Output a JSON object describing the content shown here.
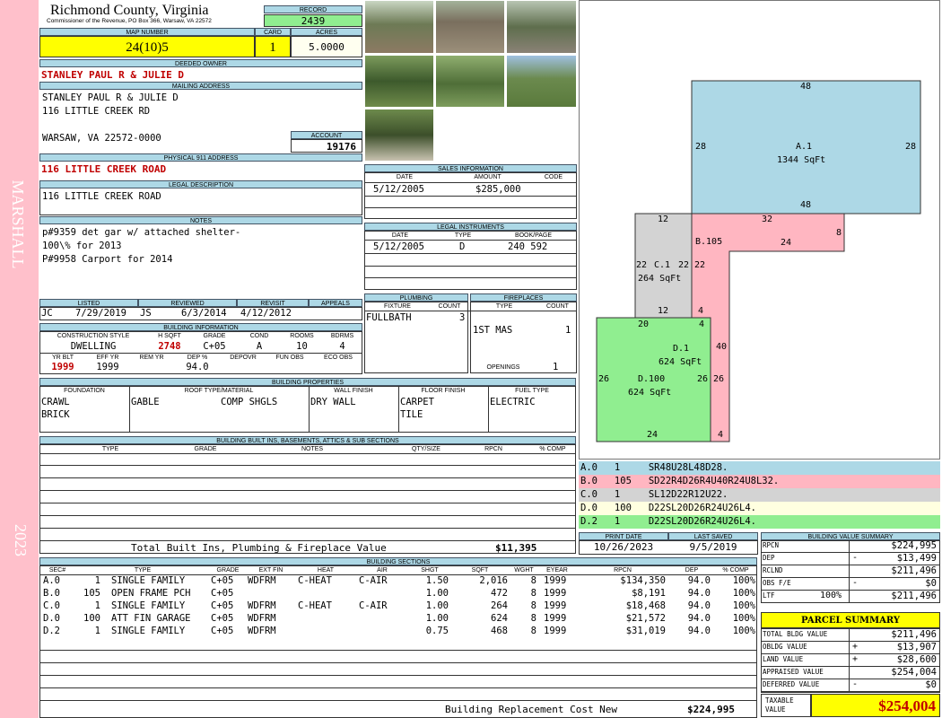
{
  "sidebar": {
    "district": "MARSHALL",
    "year": "2023"
  },
  "header": {
    "county": "Richmond County, Virginia",
    "commissioner": "Commissioner of the Revenue, PO Box 366, Warsaw, VA 22572"
  },
  "record": {
    "label": "RECORD",
    "value": "2439"
  },
  "map": {
    "map_label": "MAP NUMBER",
    "map_number": "24(10)5",
    "card_label": "CARD",
    "card": "1",
    "acres_label": "ACRES",
    "acres": "5.0000"
  },
  "owner": {
    "deeded_label": "DEEDED OWNER",
    "deeded": "STANLEY PAUL R & JULIE D",
    "mailing_label": "MAILING ADDRESS",
    "mailing_lines": [
      "STANLEY PAUL R & JULIE D",
      "116 LITTLE CREEK RD",
      "",
      "WARSAW, VA 22572-0000"
    ],
    "account_label": "ACCOUNT",
    "account": "19176"
  },
  "physical": {
    "label": "PHYSICAL 911 ADDRESS",
    "value": "116 LITTLE CREEK ROAD"
  },
  "legal": {
    "label": "LEGAL DESCRIPTION",
    "value": "116 LITTLE CREEK ROAD"
  },
  "notes": {
    "label": "NOTES",
    "lines": [
      "p#9359 det gar w/ attached shelter-",
      "100\\% for 2013",
      "P#9958 Carport for 2014"
    ]
  },
  "sales": {
    "label": "SALES INFORMATION",
    "cols": [
      "DATE",
      "AMOUNT",
      "CODE"
    ],
    "rows": [
      {
        "date": "5/12/2005",
        "amount": "$285,000",
        "code": ""
      }
    ]
  },
  "legal_instruments": {
    "label": "LEGAL INSTRUMENTS",
    "cols": [
      "DATE",
      "TYPE",
      "BOOK/PAGE"
    ],
    "rows": [
      {
        "date": "5/12/2005",
        "type": "D",
        "book": "240 592"
      }
    ]
  },
  "listing": {
    "cols": [
      "LISTED",
      "REVIEWED",
      "REVISIT",
      "APPEALS"
    ],
    "listed_by": "JC",
    "listed_date": "7/29/2019",
    "reviewed_by": "JS",
    "reviewed_date": "6/3/2014",
    "revisit": "4/12/2012",
    "appeals": ""
  },
  "building_info": {
    "label": "BUILDING INFORMATION",
    "cols": [
      "CONSTRUCTION STYLE",
      "H SQFT",
      "GRADE",
      "COND",
      "ROOMS",
      "BDRMS"
    ],
    "style": "DWELLING",
    "hsqft": "2748",
    "grade": "C+05",
    "cond": "A",
    "rooms": "10",
    "bdrms": "4",
    "cols2": [
      "YR BLT",
      "EFF YR",
      "REM YR",
      "DEP %",
      "DEPOVR",
      "FUN OBS",
      "ECO OBS"
    ],
    "yr_blt": "1999",
    "eff_yr": "1999",
    "rem_yr": "",
    "dep": "94.0",
    "depovr": "",
    "fun_obs": "",
    "eco_obs": ""
  },
  "plumbing": {
    "label": "PLUMBING",
    "cols": [
      "FIXTURE",
      "COUNT"
    ],
    "fixture": "FULLBATH",
    "count": "3"
  },
  "fireplaces": {
    "label": "FIREPLACES",
    "cols": [
      "TYPE",
      "COUNT"
    ],
    "type": "1ST MAS",
    "count": "1",
    "openings_label": "OPENINGS",
    "openings": "1"
  },
  "properties": {
    "label": "BUILDING PROPERTIES",
    "cols": [
      "FOUNDATION",
      "ROOF TYPE/MATERIAL",
      "WALL FINISH",
      "FLOOR FINISH",
      "FUEL TYPE"
    ],
    "foundation": [
      "CRAWL",
      "BRICK"
    ],
    "roof_type": "GABLE",
    "roof_mat": "COMP SHGLS",
    "wall": "DRY WALL",
    "floor": [
      "CARPET",
      "TILE"
    ],
    "fuel": "ELECTRIC"
  },
  "builtins": {
    "label": "BUILDING BUILT INS, BASEMENTS, ATTICS & SUB SECTIONS",
    "cols": [
      "TYPE",
      "GRADE",
      "NOTES",
      "QTY/SIZE",
      "RPCN",
      "% COMP"
    ],
    "total_label": "Total Built Ins, Plumbing & Fireplace Value",
    "total": "$11,395"
  },
  "sketch": {
    "areas": [
      {
        "code": "A.1",
        "sqft": "1344 SqFt"
      },
      {
        "code": "B.105",
        "sqft": ""
      },
      {
        "code": "C.1",
        "sqft": "264 SqFt"
      },
      {
        "code": "D.1",
        "sqft": "624 SqFt"
      },
      {
        "code": "D.100",
        "sqft": "624 SqFt"
      }
    ],
    "dims": [
      "48",
      "28",
      "28",
      "48",
      "12",
      "32",
      "24",
      "8",
      "22",
      "22",
      "22",
      "12",
      "4",
      "40",
      "20",
      "4",
      "26",
      "26",
      "26",
      "24",
      "4"
    ]
  },
  "legend": [
    {
      "line": "A.0   1     SR48U28L48D28.",
      "color": "#add8e6"
    },
    {
      "line": "B.0   105   SD22R4D26R4U40R24U8L32.",
      "color": "#ffb6c1"
    },
    {
      "line": "C.0   1     SL12D22R12U22.",
      "color": "#d3d3d3"
    },
    {
      "line": "D.0   100   D22SL20D26R24U26L4.",
      "color": "#ffffe0"
    },
    {
      "line": "D.2   1     D22SL20D26R24U26L4.",
      "color": "#90ee90"
    }
  ],
  "dates": {
    "print_label": "PRINT DATE",
    "print": "10/26/2023",
    "saved_label": "LAST SAVED",
    "saved": "9/5/2019"
  },
  "sections": {
    "label": "BUILDING SECTIONS",
    "cols": [
      "SEC#",
      "TYPE",
      "GRADE",
      "EXT FIN",
      "HEAT",
      "AIR",
      "SHGT",
      "SQFT",
      "WGHT",
      "EYEAR",
      "RPCN",
      "DEP",
      "% COMP"
    ],
    "rows": [
      {
        "sec": "A.0",
        "num": "1",
        "type": "SINGLE FAMILY",
        "grade": "C+05",
        "ext": "WDFRM",
        "heat": "C-HEAT",
        "air": "C-AIR",
        "shgt": "1.50",
        "sqft": "2,016",
        "wght": "8",
        "eyear": "1999",
        "rpcn": "$134,350",
        "dep": "94.0",
        "comp": "100%"
      },
      {
        "sec": "B.0",
        "num": "105",
        "type": "OPEN FRAME PCH",
        "grade": "C+05",
        "ext": "",
        "heat": "",
        "air": "",
        "shgt": "1.00",
        "sqft": "472",
        "wght": "8",
        "eyear": "1999",
        "rpcn": "$8,191",
        "dep": "94.0",
        "comp": "100%"
      },
      {
        "sec": "C.0",
        "num": "1",
        "type": "SINGLE FAMILY",
        "grade": "C+05",
        "ext": "WDFRM",
        "heat": "C-HEAT",
        "air": "C-AIR",
        "shgt": "1.00",
        "sqft": "264",
        "wght": "8",
        "eyear": "1999",
        "rpcn": "$18,468",
        "dep": "94.0",
        "comp": "100%"
      },
      {
        "sec": "D.0",
        "num": "100",
        "type": "ATT FIN GARAGE",
        "grade": "C+05",
        "ext": "WDFRM",
        "heat": "",
        "air": "",
        "shgt": "1.00",
        "sqft": "624",
        "wght": "8",
        "eyear": "1999",
        "rpcn": "$21,572",
        "dep": "94.0",
        "comp": "100%"
      },
      {
        "sec": "D.2",
        "num": "1",
        "type": "SINGLE FAMILY",
        "grade": "C+05",
        "ext": "WDFRM",
        "heat": "",
        "air": "",
        "shgt": "0.75",
        "sqft": "468",
        "wght": "8",
        "eyear": "1999",
        "rpcn": "$31,019",
        "dep": "94.0",
        "comp": "100%"
      }
    ],
    "replacement_label": "Building Replacement Cost New",
    "replacement": "$224,995"
  },
  "bvs": {
    "label": "BUILDING VALUE SUMMARY",
    "rows": [
      {
        "label": "RPCN",
        "sign": "",
        "pct": "",
        "value": "$224,995"
      },
      {
        "label": "DEP",
        "sign": "-",
        "pct": "",
        "value": "$13,499"
      },
      {
        "label": "RCLND",
        "sign": "",
        "pct": "",
        "value": "$211,496"
      },
      {
        "label": "OBS F/E",
        "sign": "-",
        "pct": "",
        "value": "$0"
      },
      {
        "label": "LTF",
        "sign": "",
        "pct": "100%",
        "value": "$211,496"
      }
    ]
  },
  "parcel": {
    "label": "PARCEL SUMMARY",
    "rows": [
      {
        "label": "TOTAL BLDG VALUE",
        "sign": "",
        "value": "$211,496"
      },
      {
        "label": "OBLDG VALUE",
        "sign": "+",
        "value": "$13,907"
      },
      {
        "label": "LAND VALUE",
        "sign": "+",
        "value": "$28,600"
      },
      {
        "label": "APPRAISED VALUE",
        "sign": "",
        "value": "$254,004"
      },
      {
        "label": "DEFERRED VALUE",
        "sign": "-",
        "value": "$0"
      }
    ],
    "taxable_label": "TAXABLE VALUE",
    "taxable": "$254,004"
  },
  "colors": {
    "sidebar": "#ffc0cb",
    "header": "#add8e6",
    "highlight": "#ffff00",
    "record_bg": "#90ee90",
    "accent_red": "#c00000"
  }
}
